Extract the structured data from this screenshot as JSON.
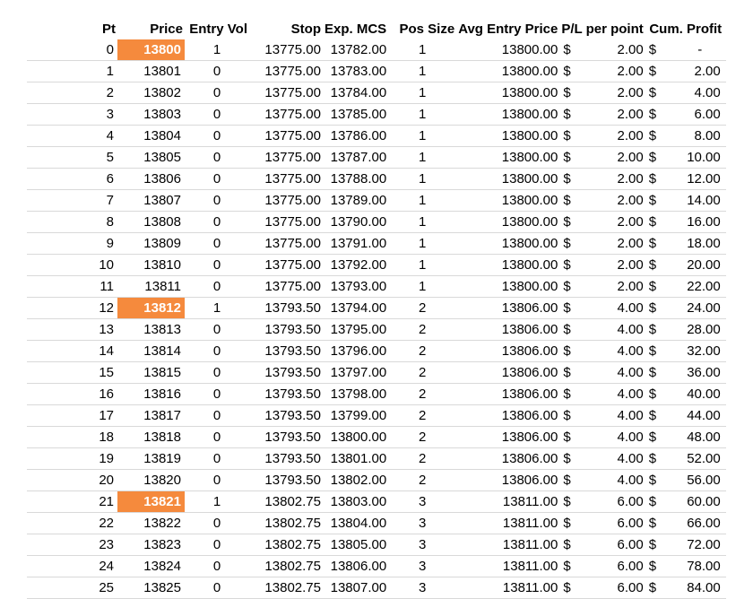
{
  "sheet": {
    "headers": {
      "pt": "Pt",
      "price": "Price",
      "entry_vol": "Entry Vol",
      "stop": "Stop",
      "exp_mcs": "Exp. MCS",
      "pos_size": "Pos Size",
      "avg_entry": "Avg Entry Price",
      "pl_per_point": "P/L per point",
      "cum_profit": "Cum. Profit"
    },
    "rows": [
      {
        "pt": "0",
        "price": "13800",
        "highlight": true,
        "entry_vol": "1",
        "stop": "13775.00",
        "exp_mcs": "13782.00",
        "pos_size": "1",
        "avg_entry": "13800.00",
        "pl_cur": "$",
        "pl": "2.00",
        "cum_cur": "$",
        "cum": "-"
      },
      {
        "pt": "1",
        "price": "13801",
        "highlight": false,
        "entry_vol": "0",
        "stop": "13775.00",
        "exp_mcs": "13783.00",
        "pos_size": "1",
        "avg_entry": "13800.00",
        "pl_cur": "$",
        "pl": "2.00",
        "cum_cur": "$",
        "cum": "2.00"
      },
      {
        "pt": "2",
        "price": "13802",
        "highlight": false,
        "entry_vol": "0",
        "stop": "13775.00",
        "exp_mcs": "13784.00",
        "pos_size": "1",
        "avg_entry": "13800.00",
        "pl_cur": "$",
        "pl": "2.00",
        "cum_cur": "$",
        "cum": "4.00"
      },
      {
        "pt": "3",
        "price": "13803",
        "highlight": false,
        "entry_vol": "0",
        "stop": "13775.00",
        "exp_mcs": "13785.00",
        "pos_size": "1",
        "avg_entry": "13800.00",
        "pl_cur": "$",
        "pl": "2.00",
        "cum_cur": "$",
        "cum": "6.00"
      },
      {
        "pt": "4",
        "price": "13804",
        "highlight": false,
        "entry_vol": "0",
        "stop": "13775.00",
        "exp_mcs": "13786.00",
        "pos_size": "1",
        "avg_entry": "13800.00",
        "pl_cur": "$",
        "pl": "2.00",
        "cum_cur": "$",
        "cum": "8.00"
      },
      {
        "pt": "5",
        "price": "13805",
        "highlight": false,
        "entry_vol": "0",
        "stop": "13775.00",
        "exp_mcs": "13787.00",
        "pos_size": "1",
        "avg_entry": "13800.00",
        "pl_cur": "$",
        "pl": "2.00",
        "cum_cur": "$",
        "cum": "10.00"
      },
      {
        "pt": "6",
        "price": "13806",
        "highlight": false,
        "entry_vol": "0",
        "stop": "13775.00",
        "exp_mcs": "13788.00",
        "pos_size": "1",
        "avg_entry": "13800.00",
        "pl_cur": "$",
        "pl": "2.00",
        "cum_cur": "$",
        "cum": "12.00"
      },
      {
        "pt": "7",
        "price": "13807",
        "highlight": false,
        "entry_vol": "0",
        "stop": "13775.00",
        "exp_mcs": "13789.00",
        "pos_size": "1",
        "avg_entry": "13800.00",
        "pl_cur": "$",
        "pl": "2.00",
        "cum_cur": "$",
        "cum": "14.00"
      },
      {
        "pt": "8",
        "price": "13808",
        "highlight": false,
        "entry_vol": "0",
        "stop": "13775.00",
        "exp_mcs": "13790.00",
        "pos_size": "1",
        "avg_entry": "13800.00",
        "pl_cur": "$",
        "pl": "2.00",
        "cum_cur": "$",
        "cum": "16.00"
      },
      {
        "pt": "9",
        "price": "13809",
        "highlight": false,
        "entry_vol": "0",
        "stop": "13775.00",
        "exp_mcs": "13791.00",
        "pos_size": "1",
        "avg_entry": "13800.00",
        "pl_cur": "$",
        "pl": "2.00",
        "cum_cur": "$",
        "cum": "18.00"
      },
      {
        "pt": "10",
        "price": "13810",
        "highlight": false,
        "entry_vol": "0",
        "stop": "13775.00",
        "exp_mcs": "13792.00",
        "pos_size": "1",
        "avg_entry": "13800.00",
        "pl_cur": "$",
        "pl": "2.00",
        "cum_cur": "$",
        "cum": "20.00"
      },
      {
        "pt": "11",
        "price": "13811",
        "highlight": false,
        "entry_vol": "0",
        "stop": "13775.00",
        "exp_mcs": "13793.00",
        "pos_size": "1",
        "avg_entry": "13800.00",
        "pl_cur": "$",
        "pl": "2.00",
        "cum_cur": "$",
        "cum": "22.00"
      },
      {
        "pt": "12",
        "price": "13812",
        "highlight": true,
        "entry_vol": "1",
        "stop": "13793.50",
        "exp_mcs": "13794.00",
        "pos_size": "2",
        "avg_entry": "13806.00",
        "pl_cur": "$",
        "pl": "4.00",
        "cum_cur": "$",
        "cum": "24.00"
      },
      {
        "pt": "13",
        "price": "13813",
        "highlight": false,
        "entry_vol": "0",
        "stop": "13793.50",
        "exp_mcs": "13795.00",
        "pos_size": "2",
        "avg_entry": "13806.00",
        "pl_cur": "$",
        "pl": "4.00",
        "cum_cur": "$",
        "cum": "28.00"
      },
      {
        "pt": "14",
        "price": "13814",
        "highlight": false,
        "entry_vol": "0",
        "stop": "13793.50",
        "exp_mcs": "13796.00",
        "pos_size": "2",
        "avg_entry": "13806.00",
        "pl_cur": "$",
        "pl": "4.00",
        "cum_cur": "$",
        "cum": "32.00"
      },
      {
        "pt": "15",
        "price": "13815",
        "highlight": false,
        "entry_vol": "0",
        "stop": "13793.50",
        "exp_mcs": "13797.00",
        "pos_size": "2",
        "avg_entry": "13806.00",
        "pl_cur": "$",
        "pl": "4.00",
        "cum_cur": "$",
        "cum": "36.00"
      },
      {
        "pt": "16",
        "price": "13816",
        "highlight": false,
        "entry_vol": "0",
        "stop": "13793.50",
        "exp_mcs": "13798.00",
        "pos_size": "2",
        "avg_entry": "13806.00",
        "pl_cur": "$",
        "pl": "4.00",
        "cum_cur": "$",
        "cum": "40.00"
      },
      {
        "pt": "17",
        "price": "13817",
        "highlight": false,
        "entry_vol": "0",
        "stop": "13793.50",
        "exp_mcs": "13799.00",
        "pos_size": "2",
        "avg_entry": "13806.00",
        "pl_cur": "$",
        "pl": "4.00",
        "cum_cur": "$",
        "cum": "44.00"
      },
      {
        "pt": "18",
        "price": "13818",
        "highlight": false,
        "entry_vol": "0",
        "stop": "13793.50",
        "exp_mcs": "13800.00",
        "pos_size": "2",
        "avg_entry": "13806.00",
        "pl_cur": "$",
        "pl": "4.00",
        "cum_cur": "$",
        "cum": "48.00"
      },
      {
        "pt": "19",
        "price": "13819",
        "highlight": false,
        "entry_vol": "0",
        "stop": "13793.50",
        "exp_mcs": "13801.00",
        "pos_size": "2",
        "avg_entry": "13806.00",
        "pl_cur": "$",
        "pl": "4.00",
        "cum_cur": "$",
        "cum": "52.00"
      },
      {
        "pt": "20",
        "price": "13820",
        "highlight": false,
        "entry_vol": "0",
        "stop": "13793.50",
        "exp_mcs": "13802.00",
        "pos_size": "2",
        "avg_entry": "13806.00",
        "pl_cur": "$",
        "pl": "4.00",
        "cum_cur": "$",
        "cum": "56.00"
      },
      {
        "pt": "21",
        "price": "13821",
        "highlight": true,
        "entry_vol": "1",
        "stop": "13802.75",
        "exp_mcs": "13803.00",
        "pos_size": "3",
        "avg_entry": "13811.00",
        "pl_cur": "$",
        "pl": "6.00",
        "cum_cur": "$",
        "cum": "60.00"
      },
      {
        "pt": "22",
        "price": "13822",
        "highlight": false,
        "entry_vol": "0",
        "stop": "13802.75",
        "exp_mcs": "13804.00",
        "pos_size": "3",
        "avg_entry": "13811.00",
        "pl_cur": "$",
        "pl": "6.00",
        "cum_cur": "$",
        "cum": "66.00"
      },
      {
        "pt": "23",
        "price": "13823",
        "highlight": false,
        "entry_vol": "0",
        "stop": "13802.75",
        "exp_mcs": "13805.00",
        "pos_size": "3",
        "avg_entry": "13811.00",
        "pl_cur": "$",
        "pl": "6.00",
        "cum_cur": "$",
        "cum": "72.00"
      },
      {
        "pt": "24",
        "price": "13824",
        "highlight": false,
        "entry_vol": "0",
        "stop": "13802.75",
        "exp_mcs": "13806.00",
        "pos_size": "3",
        "avg_entry": "13811.00",
        "pl_cur": "$",
        "pl": "6.00",
        "cum_cur": "$",
        "cum": "78.00"
      },
      {
        "pt": "25",
        "price": "13825",
        "highlight": false,
        "entry_vol": "0",
        "stop": "13802.75",
        "exp_mcs": "13807.00",
        "pos_size": "3",
        "avg_entry": "13811.00",
        "pl_cur": "$",
        "pl": "6.00",
        "cum_cur": "$",
        "cum": "84.00"
      }
    ],
    "colors": {
      "highlight_fill": "#f58a3d",
      "highlight_text": "#ffffff",
      "row_border": "#d9d9d9"
    }
  }
}
